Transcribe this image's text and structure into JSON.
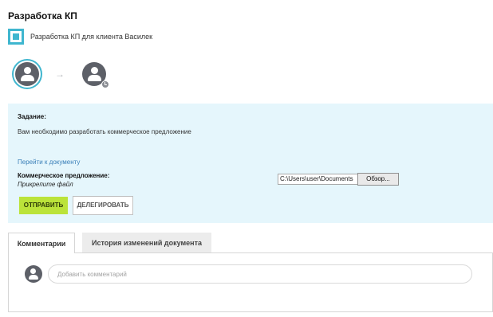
{
  "page": {
    "title": "Разработка КП"
  },
  "task": {
    "name": "Разработка КП для клиента Василек",
    "icon": "task-square-icon"
  },
  "flow": {
    "steps": [
      {
        "icon": "user-avatar-icon",
        "state": "active"
      },
      {
        "icon": "user-avatar-pending-icon",
        "state": "pending"
      }
    ],
    "arrow": "→"
  },
  "assignment": {
    "label": "Задание:",
    "text": "Вам необходимо разработать коммерческое предложение",
    "doc_link": "Перейти к документу",
    "offer_label": "Коммерческое предложение:",
    "attach_hint": "Прикрепите файл",
    "file_path": "C:\\Users\\user\\Documents",
    "browse_label": "Обзор..."
  },
  "actions": {
    "send_label": "ОТПРАВИТЬ",
    "delegate_label": "ДЕЛЕГИРОВАТЬ"
  },
  "tabs": [
    {
      "label": "Комментарии",
      "active": true
    },
    {
      "label": "История изменений документа",
      "active": false
    }
  ],
  "comments": {
    "placeholder": "Добавить комментарий"
  },
  "colors": {
    "accent": "#3fb6cf",
    "panel_bg": "#e5f6fc",
    "send_button": "#bbe33a",
    "link": "#3a7fb8"
  }
}
